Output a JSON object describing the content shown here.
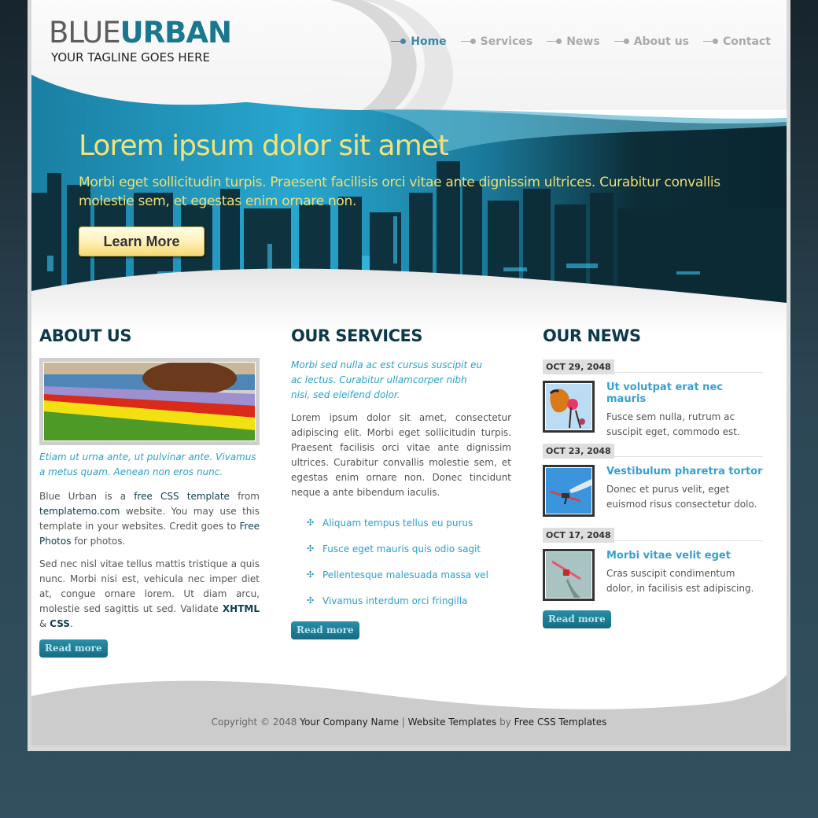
{
  "brand": {
    "logo_light": "BLUE",
    "logo_bold": "URBAN",
    "tagline": "YOUR TAGLINE GOES HERE"
  },
  "nav": {
    "items": [
      {
        "label": "Home",
        "active": true
      },
      {
        "label": "Services",
        "active": false
      },
      {
        "label": "News",
        "active": false
      },
      {
        "label": "About us",
        "active": false
      },
      {
        "label": "Contact",
        "active": false
      }
    ]
  },
  "banner": {
    "title": "Lorem ipsum dolor sit amet",
    "text": "Morbi eget sollicitudin turpis. Praesent facilisis orci vitae ante dignissim ultrices. Curabitur convallis molestie sem, et egestas enim ornare non.",
    "button_label": "Learn More"
  },
  "about": {
    "heading": "ABOUT US",
    "image_alt": "flower-garden",
    "lead": "Etiam ut urna ante, ut pulvinar ante. Vivamus a metus quam. Aenean non eros nunc.",
    "p1": {
      "t1": "Blue Urban is a ",
      "link1": "free CSS template",
      "t2": " from ",
      "link2": "templatemo.com",
      "t3": " website. You may use this template in your websites. Credit goes to ",
      "link3": "Free Photos",
      "t4": " for photos."
    },
    "p2": {
      "t1": "Sed nec nisl vitae tellus mattis tristique a quis nunc. Morbi nisi est, vehicula nec imper diet at, congue ornare lorem. Ut diam arcu, molestie sed sagittis ut sed. Validate ",
      "link1": "XHTML",
      "t2": " & ",
      "link2": "CSS",
      "t3": "."
    },
    "read_more": "Read more"
  },
  "services": {
    "heading": "OUR SERVICES",
    "lead": "Morbi sed nulla ac est cursus suscipit eu ac lectus. Curabitur ullamcorper nibh nisi, sed eleifend dolor.",
    "body": "Lorem ipsum dolor sit amet, consectetur adipiscing elit. Morbi eget sollicitudin turpis. Praesent facilisis orci vitae ante dignissim ultrices. Curabitur convallis molestie sem, et egestas enim ornare non. Donec tincidunt neque a ante bibendum iaculis.",
    "list": [
      "Aliquam tempus tellus eu purus",
      "Fusce eget mauris quis odio sagit",
      "Pellentesque malesuada massa vel",
      "Vivamus interdum orci fringilla"
    ],
    "bullet_icon": "✣",
    "read_more": "Read more"
  },
  "news": {
    "heading": "OUR NEWS",
    "items": [
      {
        "date": "OCT 29, 2048",
        "title": "Ut volutpat erat nec mauris",
        "text": "Fusce sem nulla, rutrum ac suscipit eget, commodo est.",
        "thumb": "butterfly"
      },
      {
        "date": "OCT 23, 2048",
        "title": "Vestibulum pharetra tortor",
        "text": "Donec et purus velit, eget euismod risus consectetur dolo.",
        "thumb": "airplane-blue-sky"
      },
      {
        "date": "OCT 17, 2048",
        "title": "Morbi vitae velit eget",
        "text": "Cras suscipit condimentum dolor, in facilisis est adipiscing.",
        "thumb": "biplane-grey-sky"
      }
    ],
    "read_more": "Read more"
  },
  "footer": {
    "copyright": "Copyright © 2048 ",
    "company": "Your Company Name",
    "sep": " | ",
    "templates": "Website Templates",
    "by": " by ",
    "free_css": "Free CSS Templates"
  },
  "colors": {
    "brand_blue": "#19778f",
    "nav_active": "#3a8aa8",
    "heading": "#0d3a4b",
    "accent_text": "#2aa2cc",
    "banner_text": "#f2e27a",
    "page_bg": "#32505f"
  }
}
